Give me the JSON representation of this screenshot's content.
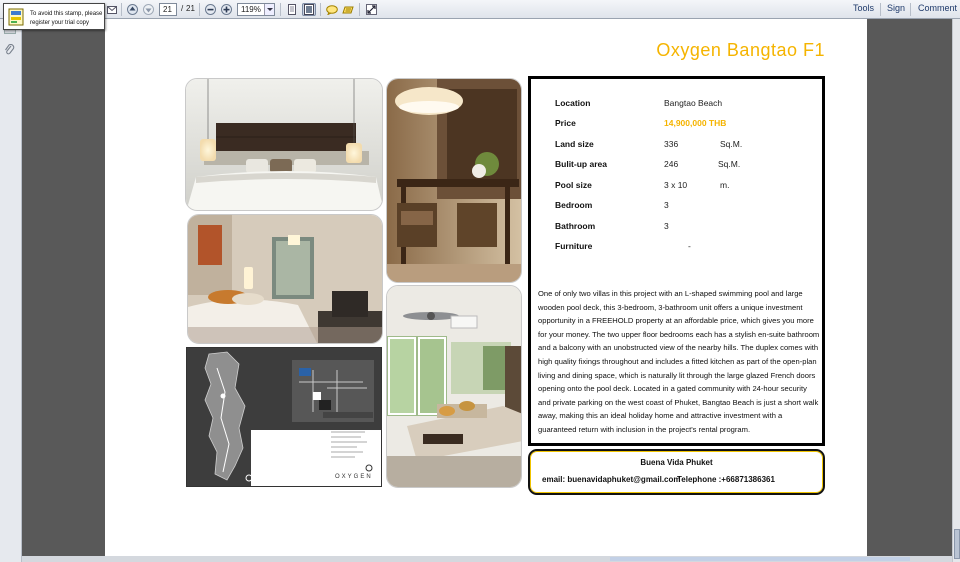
{
  "toolbar": {
    "page_current": "21",
    "page_sep": "/",
    "page_total": "21",
    "zoom": "119%",
    "tools": "Tools",
    "sign": "Sign",
    "comment": "Comment"
  },
  "stamp": {
    "text_line1": "To avoid this stamp, please",
    "text_line2": "register your trial copy"
  },
  "listing": {
    "title": "Oxygen Bangtao F1",
    "rows": [
      {
        "label": "Location",
        "value": "Bangtao Beach",
        "unit": ""
      },
      {
        "label": "Price",
        "value": "14,900,000 THB",
        "unit": ""
      },
      {
        "label": "Land size",
        "value": "336",
        "unit": "Sq.M."
      },
      {
        "label": "Bulit-up area",
        "value": "246",
        "unit": "Sq.M."
      },
      {
        "label": "Pool size",
        "value": "3 x 10",
        "unit": "m."
      },
      {
        "label": "Bedroom",
        "value": "3",
        "unit": ""
      },
      {
        "label": "Bathroom",
        "value": "3",
        "unit": ""
      },
      {
        "label": "Furniture",
        "value": "-",
        "unit": ""
      }
    ],
    "description": "One of only two villas in this project with an L-shaped swimming pool and large wooden pool deck, this 3-bedroom, 3-bathroom unit offers a unique investment opportunity in a FREEHOLD property at an affordable price, which gives you more for your money. The two upper floor bedrooms each has a stylish en-suite bathroom and a balcony with an unobstructed view of the nearby hills. The duplex comes with high quality fixings throughout and includes a fitted kitchen as part of the open-plan living and dining space, which is naturally lit through the large glazed French doors opening onto the pool deck. Located in a gated community with 24-hour security and private parking on the west coast of Phuket, Bangtao Beach is just a short walk away, making this an ideal holiday home and attractive investment with a guaranteed return with inclusion in the project's rental program."
  },
  "contact": {
    "company": "Buena Vida Phuket",
    "email": "email: buenavidaphuket@gmail.com",
    "phone": "Telephone :+66871386361"
  },
  "map": {
    "brand": "OXYGEN"
  },
  "colors": {
    "accent": "#f5b400",
    "viewer_bg": "#595959"
  },
  "icons": [
    "hand-icon",
    "zoom-icon",
    "page-up-icon",
    "page-down-icon",
    "zoom-out-icon",
    "zoom-in-icon",
    "fit-page-icon",
    "fit-width-icon",
    "comment-icon",
    "highlight-icon",
    "expand-icon",
    "stamp-icon",
    "attachment-icon"
  ]
}
